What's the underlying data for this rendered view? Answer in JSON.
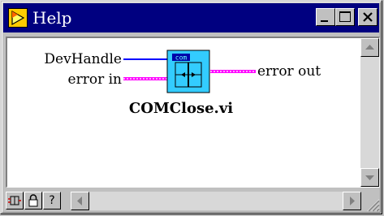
{
  "window": {
    "title": "Help"
  },
  "diagram": {
    "inputs": [
      "DevHandle",
      "error in"
    ],
    "outputs": [
      "error out"
    ],
    "vi_icon_text": "com",
    "vi_name": "COMClose.vi"
  },
  "toolbar": {
    "question_label": "?"
  },
  "colors": {
    "titlebar": "#000080",
    "wire_refnum": "#0000ff",
    "wire_error": "#ff00ff",
    "vi_icon_bg": "#33ccff"
  }
}
